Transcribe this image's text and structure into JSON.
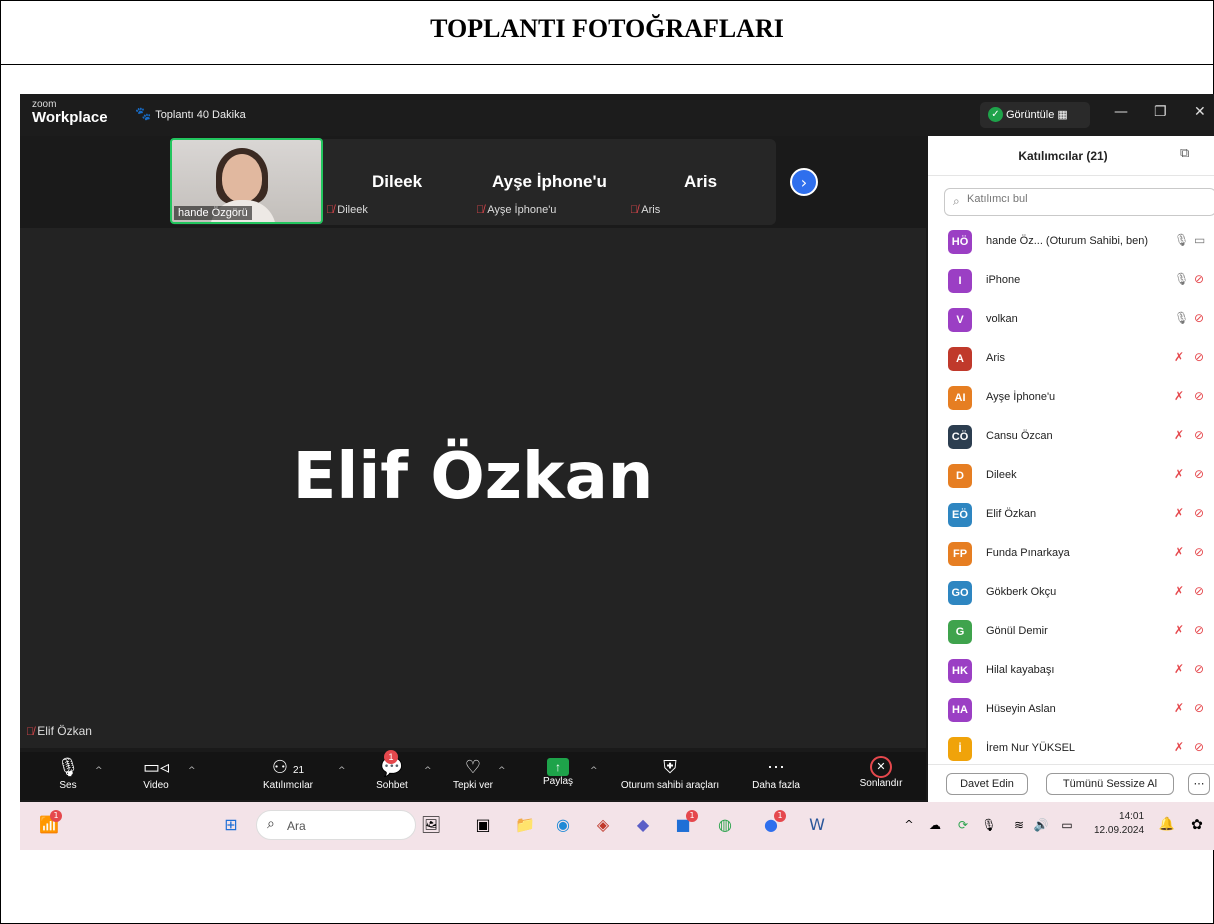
{
  "document": {
    "title": "TOPLANTI FOTOĞRAFLARI"
  },
  "app": {
    "logo_top": "zoom",
    "logo_bottom": "Workplace",
    "meeting_title": "Toplantı 40 Dakika",
    "view_label": "Görüntüle"
  },
  "strip": {
    "self_label": "hande Özgörü",
    "tiles": [
      {
        "name": "Dileek",
        "label": "Dileek"
      },
      {
        "name": "Ayşe İphone'u",
        "label": "Ayşe İphone'u"
      },
      {
        "name": "Aris",
        "label": "Aris"
      }
    ]
  },
  "main": {
    "speaker_name": "Elif Özkan",
    "speaker_label": "Elif Özkan"
  },
  "toolbar": {
    "audio": "Ses",
    "video": "Video",
    "participants": "Katılımcılar",
    "participants_count": "21",
    "chat": "Sohbet",
    "chat_badge": "1",
    "reactions": "Tepki ver",
    "share": "Paylaş",
    "host_tools": "Oturum sahibi araçları",
    "more": "Daha fazla",
    "end": "Sonlandır"
  },
  "panel": {
    "title": "Katılımcılar (21)",
    "search_placeholder": "Katılımcı bul",
    "participants": [
      {
        "initials": "HÖ",
        "name": "hande Öz...  (Oturum Sahibi, ben)",
        "color": "#9b3fc4",
        "mic": "on",
        "cam": "on"
      },
      {
        "initials": "I",
        "name": "iPhone",
        "color": "#9b3fc4",
        "mic": "on",
        "cam": "off"
      },
      {
        "initials": "V",
        "name": "volkan",
        "color": "#9b3fc4",
        "mic": "on",
        "cam": "off"
      },
      {
        "initials": "A",
        "name": "Aris",
        "color": "#c0392b",
        "mic": "off",
        "cam": "off"
      },
      {
        "initials": "AI",
        "name": "Ayşe İphone'u",
        "color": "#e67e22",
        "mic": "off",
        "cam": "off"
      },
      {
        "initials": "CÖ",
        "name": "Cansu Özcan",
        "color": "#2c3e50",
        "mic": "off",
        "cam": "off"
      },
      {
        "initials": "D",
        "name": "Dileek",
        "color": "#e67e22",
        "mic": "off",
        "cam": "off"
      },
      {
        "initials": "EÖ",
        "name": "Elif Özkan",
        "color": "#2e86c1",
        "mic": "off",
        "cam": "off"
      },
      {
        "initials": "FP",
        "name": "Funda Pınarkaya",
        "color": "#e67e22",
        "mic": "off",
        "cam": "off"
      },
      {
        "initials": "GO",
        "name": "Gökberk Okçu",
        "color": "#2e86c1",
        "mic": "off",
        "cam": "off"
      },
      {
        "initials": "G",
        "name": "Gönül Demir",
        "color": "#3fa34d",
        "mic": "off",
        "cam": "off"
      },
      {
        "initials": "HK",
        "name": "Hilal kayabaşı",
        "color": "#9b3fc4",
        "mic": "off",
        "cam": "off"
      },
      {
        "initials": "HA",
        "name": "Hüseyin Aslan",
        "color": "#9b3fc4",
        "mic": "off",
        "cam": "off"
      },
      {
        "initials": "İ",
        "name": "İrem Nur YÜKSEL",
        "color": "#f0a30a",
        "mic": "off",
        "cam": "off"
      }
    ],
    "invite": "Davet Edin",
    "mute_all": "Tümünü Sessize Al"
  },
  "taskbar": {
    "search": "Ara",
    "time": "14:01",
    "date": "12.09.2024",
    "weather_badge": "1",
    "teams_badge": "1",
    "zoom_badge": "1"
  }
}
